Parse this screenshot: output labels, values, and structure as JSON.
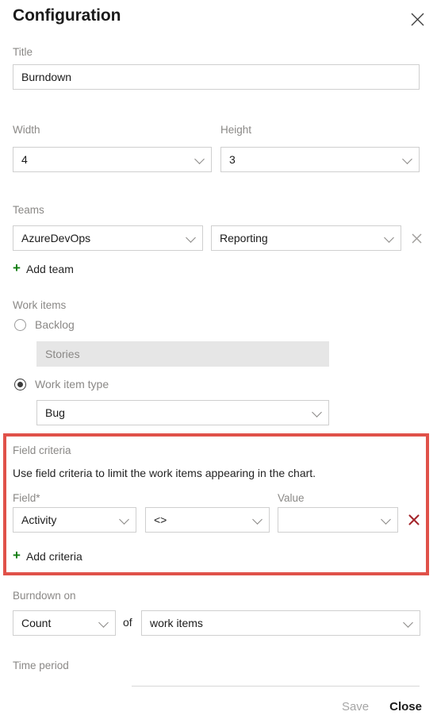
{
  "header": {
    "title": "Configuration",
    "close_icon": "close-icon"
  },
  "title_section": {
    "label": "Title",
    "value": "Burndown",
    "placeholder": ""
  },
  "size_section": {
    "width_label": "Width",
    "width_value": "4",
    "height_label": "Height",
    "height_value": "3"
  },
  "teams_section": {
    "label": "Teams",
    "project_value": "AzureDevOps",
    "team_value": "Reporting",
    "remove_icon": "close-icon",
    "add_label": "Add team",
    "add_icon": "plus-icon"
  },
  "workitems_section": {
    "label": "Work items",
    "backlog_label": "Backlog",
    "backlog_selected": false,
    "backlog_value": "Stories",
    "workitemtype_label": "Work item type",
    "workitemtype_selected": true,
    "workitemtype_value": "Bug"
  },
  "criteria_section": {
    "label": "Field criteria",
    "description": "Use field criteria to limit the work items appearing in the chart.",
    "field_label": "Field*",
    "field_value": "Activity",
    "operator_value": "<>",
    "value_label": "Value",
    "value_value": "",
    "remove_icon": "close-icon",
    "add_label": "Add criteria",
    "add_icon": "plus-icon",
    "highlight_color": "#e05149"
  },
  "burndown_section": {
    "label": "Burndown on",
    "aggregation_value": "Count",
    "of_label": "of",
    "target_value": "work items"
  },
  "timeperiod_section": {
    "label": "Time period"
  },
  "footer": {
    "save_label": "Save",
    "save_disabled": true,
    "close_label": "Close"
  }
}
